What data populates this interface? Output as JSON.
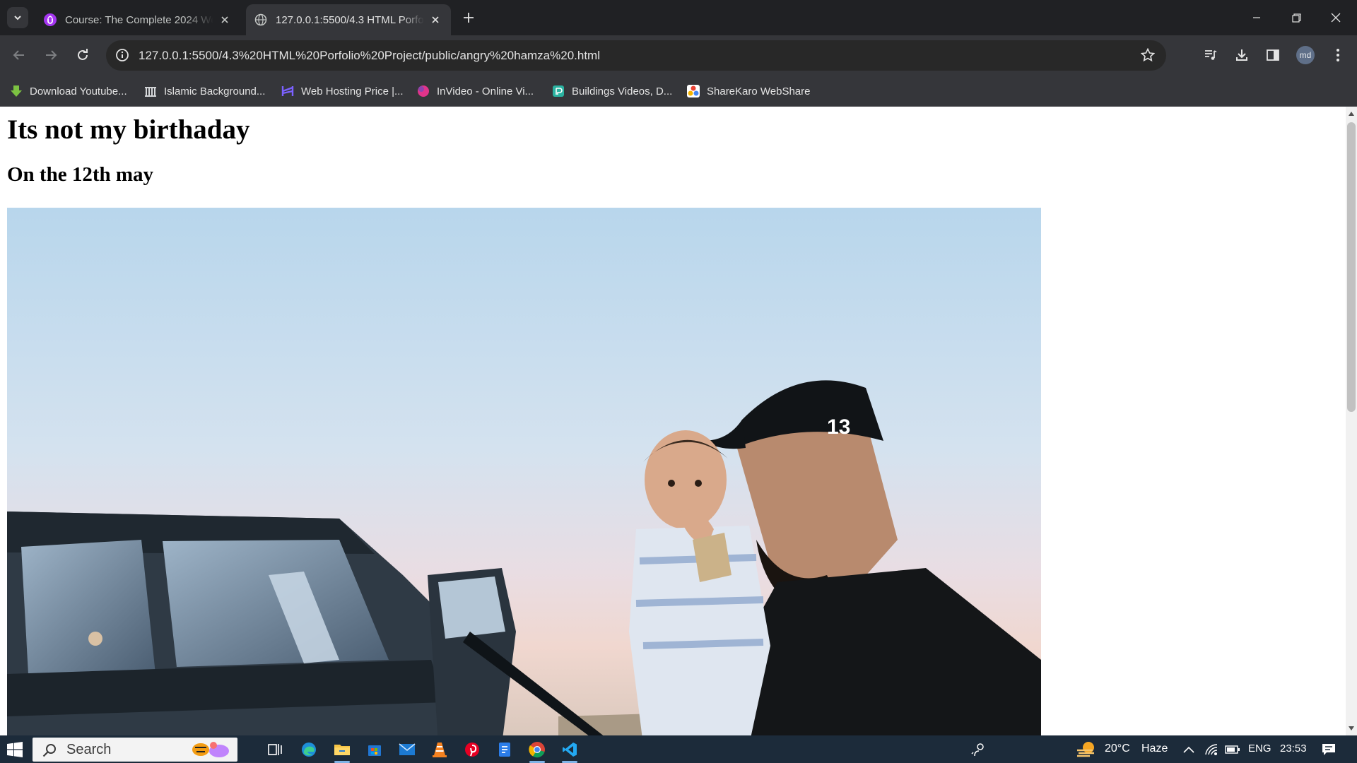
{
  "browser": {
    "tabs": [
      {
        "title": "Course: The Complete 2024 We",
        "active": false
      },
      {
        "title": "127.0.0.1:5500/4.3 HTML Porfolio",
        "active": true
      }
    ],
    "address_bar": {
      "url": "127.0.0.1:5500/4.3%20HTML%20Porfolio%20Project/public/angry%20hamza%20.html"
    },
    "profile_initials": "md",
    "bookmarks": [
      {
        "label": "Download Youtube...",
        "icon": "download-arrow-icon",
        "color": "#7cc242"
      },
      {
        "label": "Islamic Background...",
        "icon": "building-columns-icon",
        "color": "#e8eaed"
      },
      {
        "label": "Web Hosting Price |...",
        "icon": "hosting-logo-icon",
        "color": "#7b61ff"
      },
      {
        "label": "InVideo - Online Vi...",
        "icon": "invideo-logo-icon",
        "color": "#e0348a"
      },
      {
        "label": "Buildings Videos, D...",
        "icon": "buildings-logo-icon",
        "color": "#2bb3a1"
      },
      {
        "label": "ShareKaro WebShare",
        "icon": "sharekaro-logo-icon",
        "color": "#f4b400"
      }
    ]
  },
  "page": {
    "heading": "Its not my birthaday",
    "subheading": "On the 12th may",
    "image": {
      "description_icon": "photo-man-with-child-and-jeep",
      "cap_number": "13"
    }
  },
  "taskbar": {
    "search_placeholder": "Search",
    "weather": {
      "temp": "20°C",
      "condition": "Haze"
    },
    "language": "ENG",
    "time": "23:53"
  }
}
